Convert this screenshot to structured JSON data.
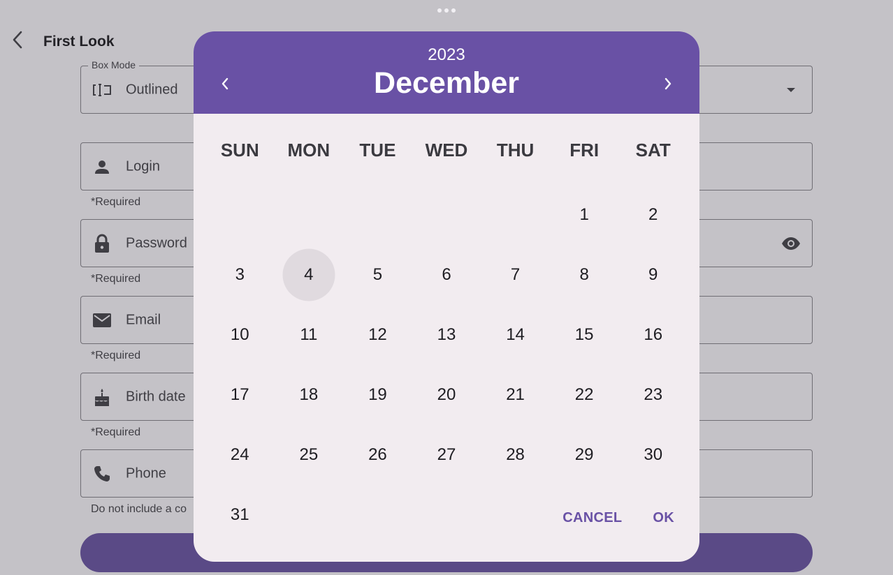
{
  "screen": {
    "title": "First Look"
  },
  "box_mode": {
    "label": "Box Mode",
    "value": "Outlined"
  },
  "fields": {
    "login": {
      "label": "Login",
      "helper": "*Required"
    },
    "password": {
      "label": "Password",
      "helper": "*Required"
    },
    "email": {
      "label": "Email",
      "helper": "*Required"
    },
    "birth_date": {
      "label": "Birth date",
      "helper": "*Required"
    },
    "phone": {
      "label": "Phone",
      "helper": "Do not include a co"
    }
  },
  "date_picker": {
    "year": "2023",
    "month": "December",
    "weekdays": [
      "SUN",
      "MON",
      "TUE",
      "WED",
      "THU",
      "FRI",
      "SAT"
    ],
    "days": [
      "",
      "",
      "",
      "",
      "",
      "1",
      "2",
      "3",
      "4",
      "5",
      "6",
      "7",
      "8",
      "9",
      "10",
      "11",
      "12",
      "13",
      "14",
      "15",
      "16",
      "17",
      "18",
      "19",
      "20",
      "21",
      "22",
      "23",
      "24",
      "25",
      "26",
      "27",
      "28",
      "29",
      "30",
      "31"
    ],
    "selected_day": "4",
    "cancel_label": "CANCEL",
    "ok_label": "OK"
  },
  "colors": {
    "header": "#6951a5",
    "dialog_bg": "#f2ecf0",
    "scrim_bg": "#c4c2c7",
    "submit_bar": "#5a4a86",
    "selected_day_bg": "#e0dadf"
  }
}
